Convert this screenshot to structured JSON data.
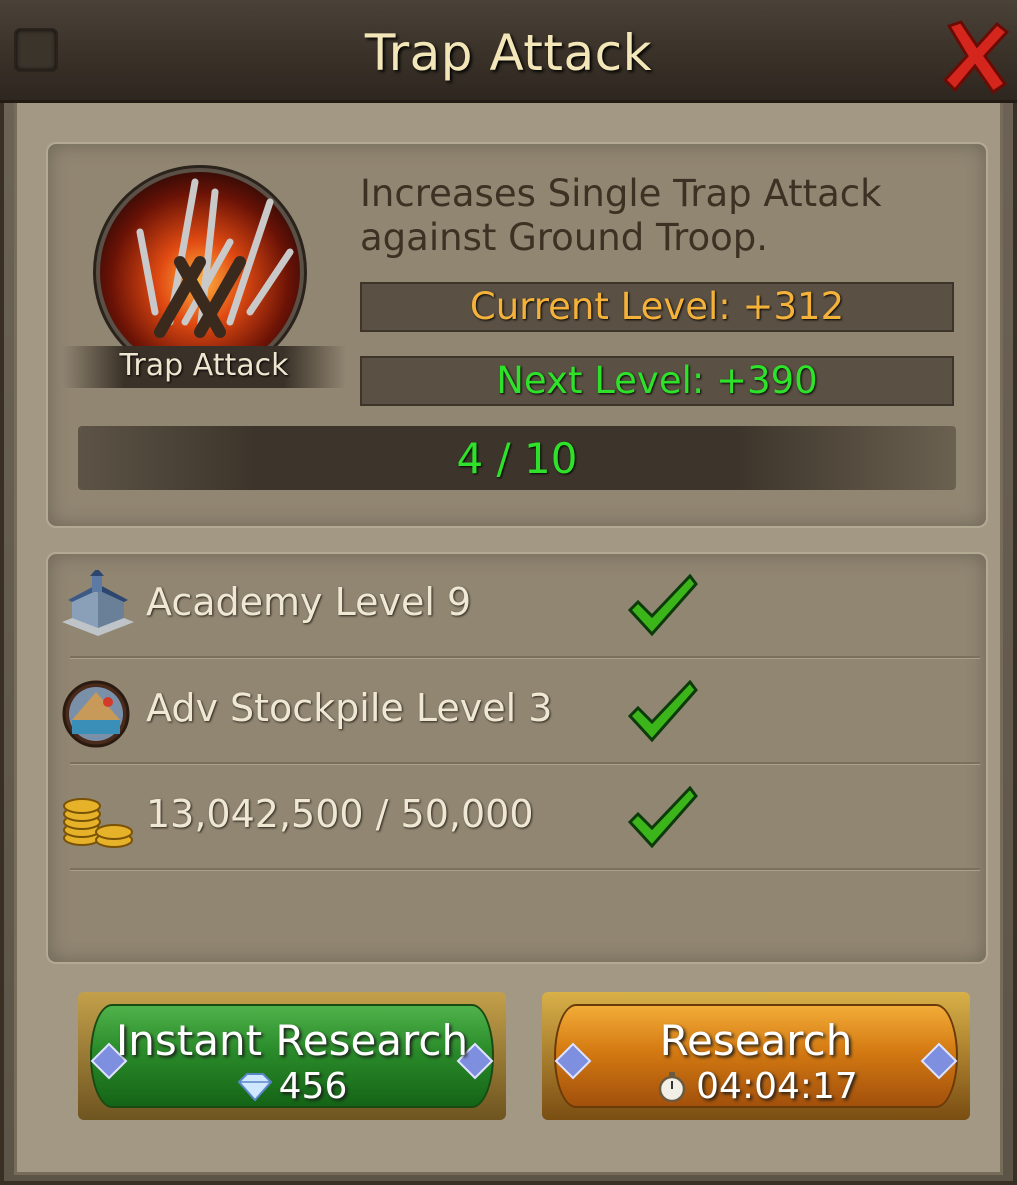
{
  "window": {
    "title": "Trap Attack"
  },
  "skill": {
    "name": "Trap Attack",
    "description_line1": "Increases Single Trap Attack",
    "description_line2": "against Ground Troop.",
    "current_level_text": "Current Level: +312",
    "next_level_text": "Next Level: +390",
    "progress_text": "4 / 10",
    "progress": {
      "current": 4,
      "max": 10
    }
  },
  "requirements": [
    {
      "label": "Academy Level 9",
      "met": true,
      "icon": "academy-building-icon"
    },
    {
      "label": "Adv Stockpile Level 3",
      "met": true,
      "icon": "stockpile-icon"
    },
    {
      "label": "13,042,500 / 50,000",
      "met": true,
      "icon": "gold-coins-icon"
    }
  ],
  "buttons": {
    "instant_research": {
      "label": "Instant Research",
      "cost": "456",
      "icon": "diamond-icon"
    },
    "research": {
      "label": "Research",
      "time": "04:04:17",
      "icon": "stopwatch-icon"
    }
  },
  "colors": {
    "current_level": "#f5b23a",
    "next_level": "#2ee22a",
    "check": "#3bb51a"
  }
}
